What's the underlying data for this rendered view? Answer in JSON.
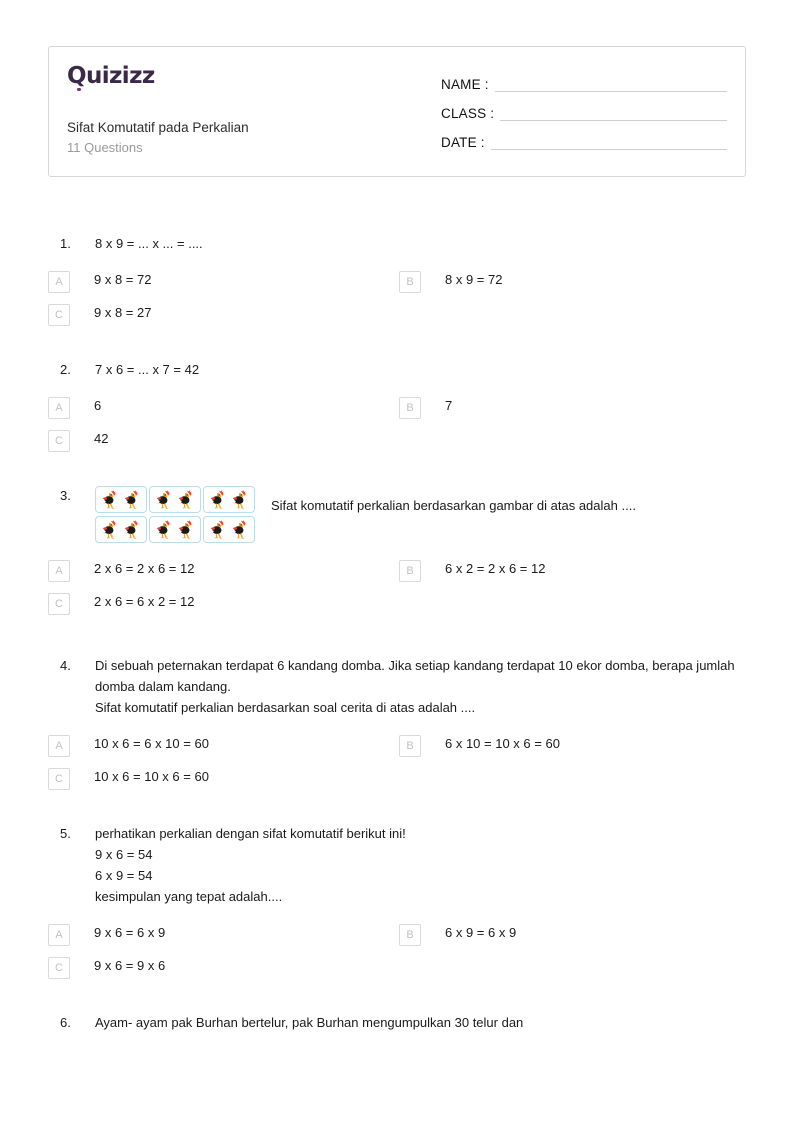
{
  "header": {
    "logo_text": "Quizizz",
    "quiz_title": "Sifat Komutatif pada Perkalian",
    "question_count": "11 Questions",
    "fields": [
      {
        "label": "NAME :",
        "value": ""
      },
      {
        "label": "CLASS :",
        "value": ""
      },
      {
        "label": "DATE  :",
        "value": ""
      }
    ]
  },
  "questions": [
    {
      "number": "1.",
      "text": "8 x 9 = ... x ... = ....",
      "options": [
        {
          "letter": "A",
          "text": "9 x 8 = 72"
        },
        {
          "letter": "B",
          "text": "8 x 9 = 72"
        },
        {
          "letter": "C",
          "text": "9 x 8 = 27"
        }
      ]
    },
    {
      "number": "2.",
      "text": "7 x 6 = ... x 7 = 42",
      "options": [
        {
          "letter": "A",
          "text": "6"
        },
        {
          "letter": "B",
          "text": "7"
        },
        {
          "letter": "C",
          "text": "42"
        }
      ]
    },
    {
      "number": "3.",
      "text": "Sifat komutatif perkalian berdasarkan gambar di atas adalah ....",
      "image": {
        "name": "rooster-array-image",
        "rows": 2,
        "columns": 3,
        "roosters_per_cell": 2
      },
      "options": [
        {
          "letter": "A",
          "text": "2 x 6 = 2 x 6 = 12"
        },
        {
          "letter": "B",
          "text": "6 x 2 = 2 x 6 = 12"
        },
        {
          "letter": "C",
          "text": "2 x 6 = 6 x 2 = 12"
        }
      ]
    },
    {
      "number": "4.",
      "text": "Di sebuah peternakan terdapat 6 kandang domba. Jika setiap kandang terdapat 10 ekor domba, berapa jumlah domba dalam kandang.\nSifat komutatif perkalian berdasarkan soal cerita di atas adalah ....",
      "options": [
        {
          "letter": "A",
          "text": "10 x 6 = 6 x 10 = 60"
        },
        {
          "letter": "B",
          "text": "6 x 10 = 10 x 6 = 60"
        },
        {
          "letter": "C",
          "text": "10 x 6 = 10 x 6 = 60"
        }
      ]
    },
    {
      "number": "5.",
      "text": "perhatikan perkalian dengan sifat komutatif berikut ini!\n9 x 6 = 54\n6 x 9 = 54\nkesimpulan yang tepat adalah....",
      "options": [
        {
          "letter": "A",
          "text": "9 x 6 = 6 x 9"
        },
        {
          "letter": "B",
          "text": "6 x 9 = 6 x 9"
        },
        {
          "letter": "C",
          "text": "9 x 6 = 9 x 6"
        }
      ]
    },
    {
      "number": "6.",
      "text": "Ayam- ayam pak Burhan bertelur, pak Burhan mengumpulkan 30 telur dan",
      "options": []
    }
  ]
}
